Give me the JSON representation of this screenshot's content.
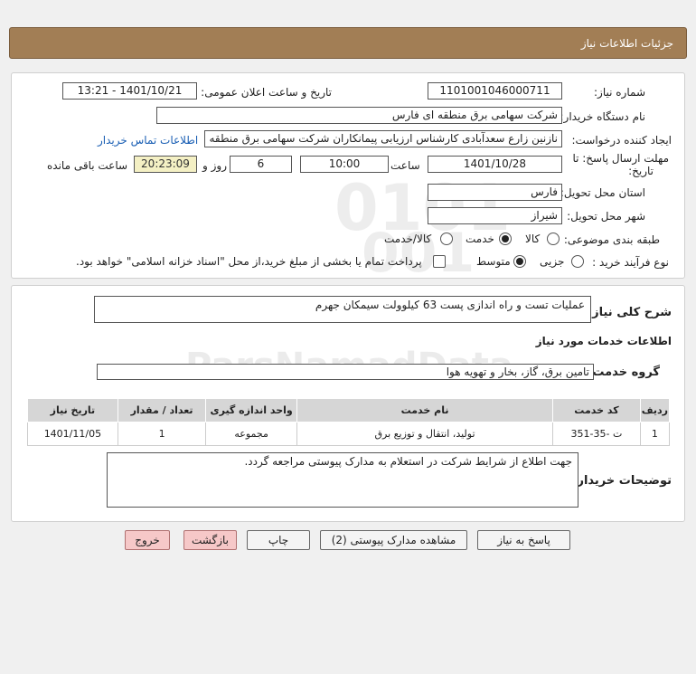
{
  "header": {
    "title": "جزئیات اطلاعات نیاز"
  },
  "need_number": {
    "label": "شماره نیاز:",
    "value": "1101001046000711"
  },
  "announce_datetime": {
    "label": "تاریخ و ساعت اعلان عمومی:",
    "value": "1401/10/21 - 13:21"
  },
  "buyer_org": {
    "label": "نام دستگاه خریدار:",
    "value": "شرکت سهامی برق منطقه ای فارس"
  },
  "requester": {
    "label": "ایجاد کننده درخواست:",
    "value": "نازنین زارع سعدآبادی کارشناس ارزیابی پیمانکاران شرکت سهامی برق منطقه ای",
    "contact_link": "اطلاعات تماس خریدار"
  },
  "deadline": {
    "label_line1": "مهلت ارسال پاسخ: تا",
    "label_line2": "تاریخ:",
    "date": "1401/10/28",
    "time_label": "ساعت",
    "time": "10:00",
    "days": "6",
    "days_label": "روز و",
    "remaining": "20:23:09",
    "remaining_label": "ساعت باقی مانده"
  },
  "province": {
    "label": "استان محل تحویل:",
    "value": "فارس"
  },
  "city": {
    "label": "شهر محل تحویل:",
    "value": "شیراز"
  },
  "category": {
    "label": "طبقه بندی موضوعی:",
    "options": [
      "کالا",
      "خدمت",
      "کالا/خدمت"
    ],
    "selected": "خدمت"
  },
  "purchase_type": {
    "label": "نوع فرآیند خرید :",
    "options": [
      "جزیی",
      "متوسط"
    ],
    "selected": "متوسط",
    "treasury_note": "پرداخت تمام یا بخشی از مبلغ خرید،از محل \"اسناد خزانه اسلامی\" خواهد بود."
  },
  "summary": {
    "label": "شرح کلی نیاز:",
    "value": "عملیات تست و راه اندازی پست 63 کیلوولت سیمکان جهرم"
  },
  "services_section": {
    "title": "اطلاعات خدمات مورد نیاز"
  },
  "service_group": {
    "label": "گروه خدمت:",
    "value": "تامین برق، گاز، بخار و تهویه هوا"
  },
  "table": {
    "headers": [
      "ردیف",
      "کد خدمت",
      "نام خدمت",
      "واحد اندازه گیری",
      "تعداد / مقدار",
      "تاریخ نیاز"
    ],
    "rows": [
      [
        "1",
        "ت -35-351",
        "تولید، انتقال و توزیع برق",
        "مجموعه",
        "1",
        "1401/11/05"
      ]
    ]
  },
  "buyer_notes": {
    "label": "توضیحات خریدار:",
    "value": "جهت اطلاع از شرایط شرکت در استعلام به مدارک پیوستی مراجعه گردد."
  },
  "buttons": {
    "reply": "پاسخ به نیاز",
    "attachments": "مشاهده مدارک پیوستی (2)",
    "print": "چاپ",
    "back": "بازگشت",
    "exit": "خروج"
  }
}
